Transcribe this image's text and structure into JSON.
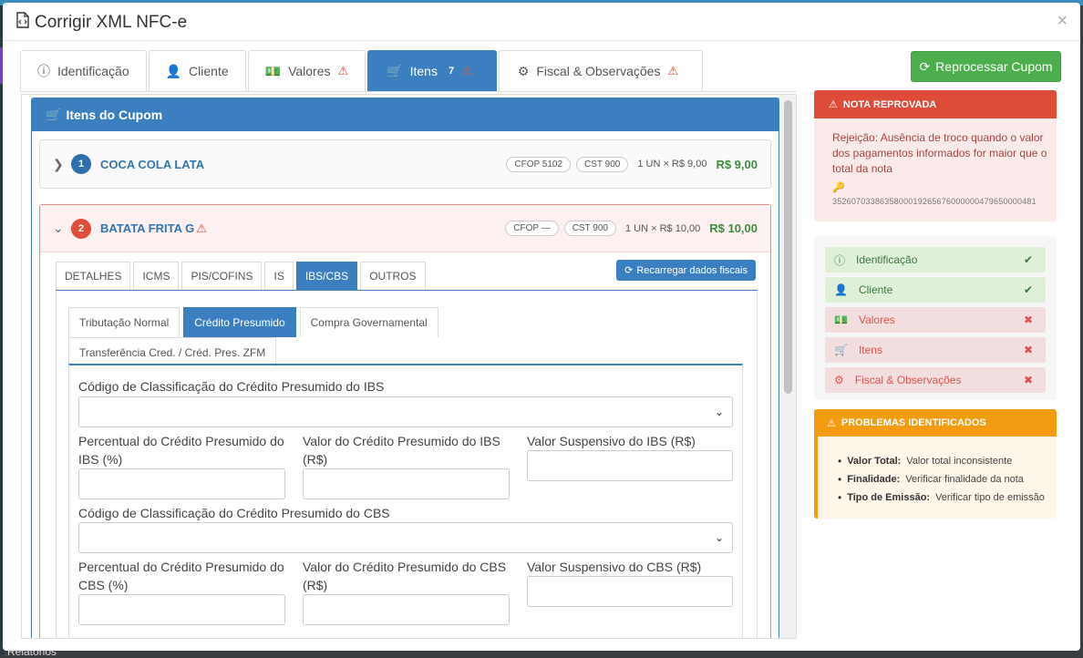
{
  "modal": {
    "title": "Corrigir XML NFC-e",
    "close": "×"
  },
  "tabs": [
    {
      "label": "Identificação",
      "icon": "info-circle-icon",
      "warning": false
    },
    {
      "label": "Cliente",
      "icon": "user-icon",
      "warning": false
    },
    {
      "label": "Valores",
      "icon": "money-icon",
      "warning": true
    },
    {
      "label": "Itens",
      "icon": "cart-icon",
      "count": "7",
      "warning": true,
      "active": true
    },
    {
      "label": "Fiscal & Observações",
      "icon": "cogs-icon",
      "warning": true
    }
  ],
  "reprocess_button": "Reprocessar Cupom",
  "items_header": "Itens do Cupom",
  "items": [
    {
      "index": "1",
      "name": "COCA COLA LATA",
      "cfop": "CFOP 5102",
      "cst": "CST 900",
      "qty": "1 UN × R$ 9,00",
      "price": "R$ 9,00",
      "error": false
    },
    {
      "index": "2",
      "name": "BATATA FRITA G",
      "cfop": "CFOP —",
      "cst": "CST 900",
      "qty": "1 UN × R$ 10,00",
      "price": "R$ 10,00",
      "error": true
    }
  ],
  "sub_tabs": [
    "DETALHES",
    "ICMS",
    "PIS/COFINS",
    "IS",
    "IBS/CBS",
    "OUTROS"
  ],
  "reload_button": "Recarregar dados fiscais",
  "ibs_tabs": [
    "Tributação Normal",
    "Crédito Presumido",
    "Compra Governamental",
    "Transferência Cred. / Créd. Pres. ZFM"
  ],
  "form": {
    "ibs_class_label": "Código de Classificação do Crédito Presumido do IBS",
    "ibs_percent_label_1": "Percentual do Crédito Presumido do",
    "ibs_percent_label_2": "IBS (%)",
    "ibs_value_label_1": "Valor do Crédito Presumido do IBS",
    "ibs_value_label_2": "(R$)",
    "ibs_susp_label": "Valor Suspensivo do IBS (R$)",
    "cbs_class_label": "Código de Classificação do Crédito Presumido do CBS",
    "cbs_percent_label_1": "Percentual do Crédito Presumido do",
    "cbs_percent_label_2": "CBS (%)",
    "cbs_value_label_1": "Valor do Crédito Presumido do CBS",
    "cbs_value_label_2": "(R$)",
    "cbs_susp_label": "Valor Suspensivo do CBS (R$)"
  },
  "reject": {
    "title": "NOTA REPROVADA",
    "text": "Rejeição: Ausência de troco quando o valor dos pagamentos informados for maior que o total da nota",
    "key": "35260703386358000192656760000004796500004​81"
  },
  "status": [
    {
      "label": "Identificação",
      "ok": true,
      "icon": "info-circle-icon"
    },
    {
      "label": "Cliente",
      "ok": true,
      "icon": "user-icon"
    },
    {
      "label": "Valores",
      "ok": false,
      "icon": "money-icon"
    },
    {
      "label": "Itens",
      "ok": false,
      "icon": "cart-icon"
    },
    {
      "label": "Fiscal & Observações",
      "ok": false,
      "icon": "cogs-icon"
    }
  ],
  "problems": {
    "title": "PROBLEMAS IDENTIFICADOS",
    "items": [
      {
        "key": "Valor Total:",
        "text": "Valor total inconsistente"
      },
      {
        "key": "Finalidade:",
        "text": "Verificar finalidade da nota"
      },
      {
        "key": "Tipo de Emissão:",
        "text": "Verificar tipo de emissão"
      }
    ]
  },
  "background": {
    "bottom_text": "Relatórios"
  }
}
